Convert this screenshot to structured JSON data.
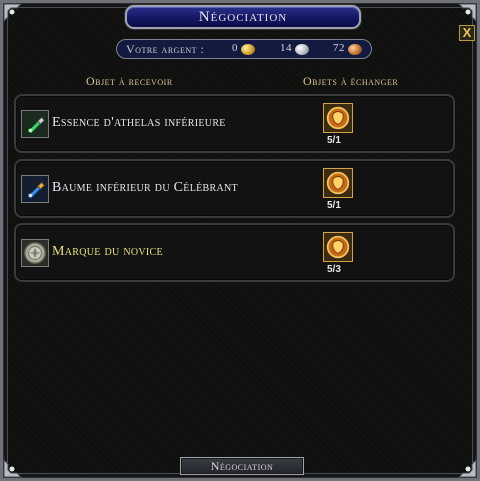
{
  "window": {
    "title": "Négociation",
    "close_label": "X"
  },
  "money": {
    "label": "Votre argent :",
    "gold": "0",
    "silver": "14",
    "copper": "72"
  },
  "columns": {
    "receive": "Objet à recevoir",
    "exchange": "Objets à échanger"
  },
  "items": [
    {
      "name": "Essence d'athelas inférieure",
      "name_color": "#e8e8ec",
      "icon": "green-potion-icon",
      "count": "5/1"
    },
    {
      "name": "Baume inférieur du Célébrant",
      "name_color": "#e8e8ec",
      "icon": "blue-potion-icon",
      "count": "5/1"
    },
    {
      "name": "Marque du novice",
      "name_color": "#e9e07a",
      "icon": "novice-mark-icon",
      "count": "5/3"
    }
  ],
  "exchange_icon": "token-icon",
  "footer": {
    "button_label": "Négociation"
  },
  "colors": {
    "title_bar": "#1a1f75",
    "money_bar": "#121a3f",
    "accent_gold": "#d2a44a"
  }
}
